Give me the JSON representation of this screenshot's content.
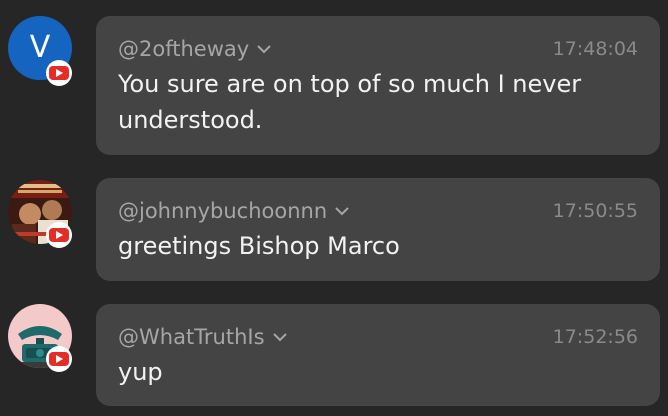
{
  "colors": {
    "background": "#262626",
    "bubble": "#444444",
    "author": "#a6a6a6",
    "timestamp": "#8a8a8a",
    "message_text": "#f2f2f2",
    "youtube_red": "#e52d27",
    "avatar_blue": "#1565c0"
  },
  "messages": [
    {
      "avatar_letter": "V",
      "avatar_icon": "letter-avatar",
      "badge_icon": "youtube-icon",
      "author": "@2oftheway",
      "dropdown_icon": "chevron-down-icon",
      "timestamp": "17:48:04",
      "text": "You sure are on top of so much I never understood."
    },
    {
      "avatar_icon": "photo-avatar",
      "badge_icon": "youtube-icon",
      "author": "@johnnybuchoonnn",
      "dropdown_icon": "chevron-down-icon",
      "timestamp": "17:50:55",
      "text": "greetings Bishop Marco"
    },
    {
      "avatar_icon": "telephone-avatar",
      "badge_icon": "youtube-icon",
      "author": "@WhatTruthIs",
      "dropdown_icon": "chevron-down-icon",
      "timestamp": "17:52:56",
      "text": "yup"
    }
  ]
}
